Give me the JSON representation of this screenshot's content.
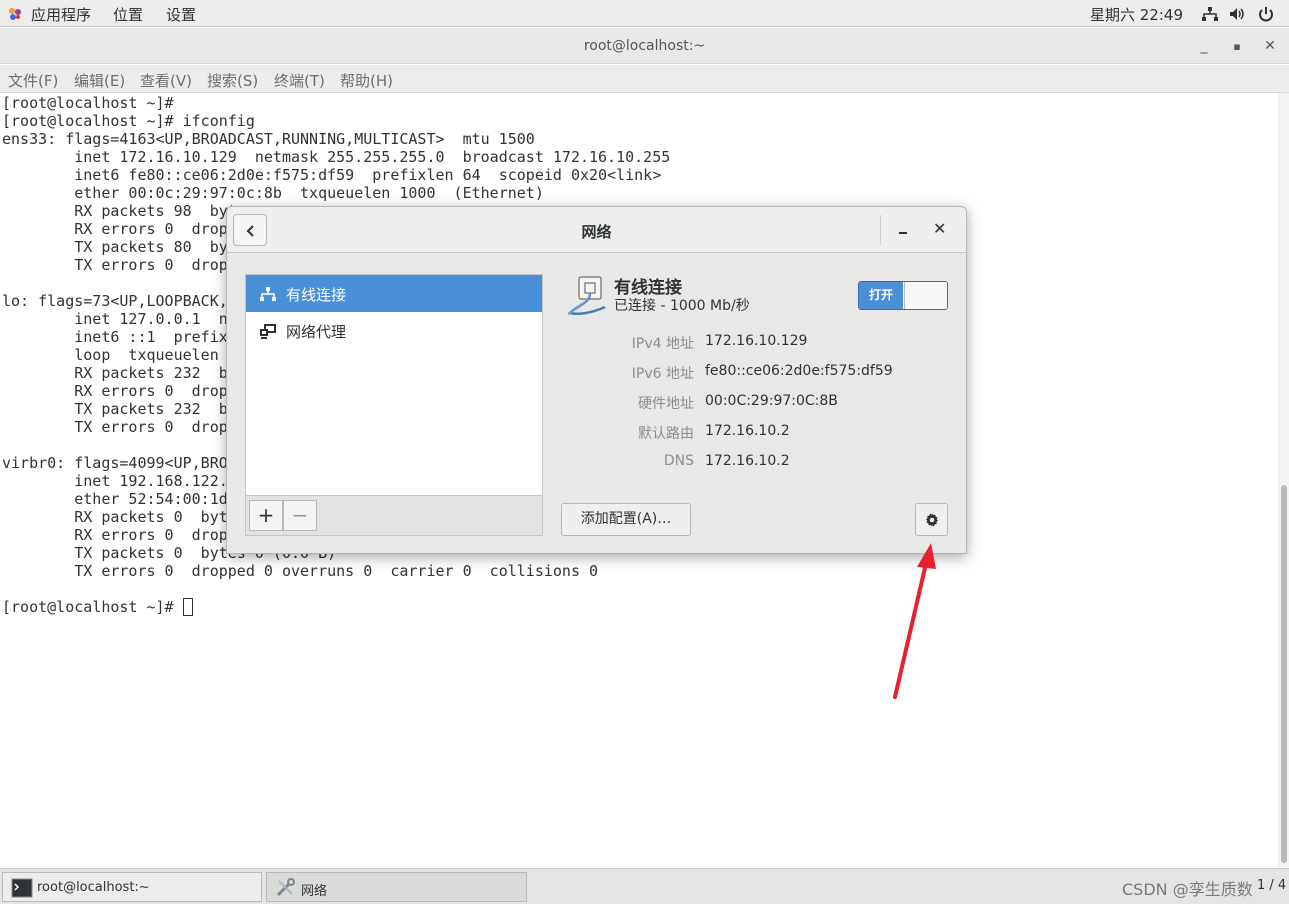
{
  "top_panel": {
    "applications": "应用程序",
    "places": "位置",
    "settings": "设置",
    "clock": "星期六 22:49"
  },
  "terminal": {
    "title": "root@localhost:~",
    "menu": [
      "文件(F)",
      "编辑(E)",
      "查看(V)",
      "搜索(S)",
      "终端(T)",
      "帮助(H)"
    ],
    "lines": [
      "[root@localhost ~]#",
      "[root@localhost ~]# ifconfig",
      "ens33: flags=4163<UP,BROADCAST,RUNNING,MULTICAST>  mtu 1500",
      "        inet 172.16.10.129  netmask 255.255.255.0  broadcast 172.16.10.255",
      "        inet6 fe80::ce06:2d0e:f575:df59  prefixlen 64  scopeid 0x20<link>",
      "        ether 00:0c:29:97:0c:8b  txqueuelen 1000  (Ethernet)",
      "        RX packets 98  byt",
      "        RX errors 0  drop",
      "        TX packets 80  by",
      "        TX errors 0  drop",
      "",
      "lo: flags=73<UP,LOOPBACK,",
      "        inet 127.0.0.1  n",
      "        inet6 ::1  prefix",
      "        loop  txqueuelen",
      "        RX packets 232  b",
      "        RX errors 0  drop",
      "        TX packets 232  b",
      "        TX errors 0  drop",
      "",
      "virbr0: flags=4099<UP,BRO",
      "        inet 192.168.122.",
      "        ether 52:54:00:1d",
      "        RX packets 0  byt",
      "        RX errors 0  drop",
      "        TX packets 0  bytes 0 (0.0 B)",
      "        TX errors 0  dropped 0 overruns 0  carrier 0  collisions 0",
      "",
      "[root@localhost ~]# "
    ]
  },
  "taskbar": {
    "tasks": [
      "root@localhost:~",
      "网络"
    ],
    "workspace": "1 / 4",
    "watermark": "CSDN @孪生质数"
  },
  "network_dialog": {
    "title": "网络",
    "list": [
      {
        "label": "有线连接",
        "icon": "wired-network-icon",
        "selected": true
      },
      {
        "label": "网络代理",
        "icon": "proxy-icon",
        "selected": false
      }
    ],
    "add_symbol": "+",
    "remove_symbol": "−",
    "connection": {
      "name": "有线连接",
      "status": "已连接 - 1000 Mb/秒",
      "toggle_label": "打开",
      "toggle_on": true
    },
    "properties": [
      {
        "key": "IPv4 地址",
        "value": "172.16.10.129"
      },
      {
        "key": "IPv6 地址",
        "value": "fe80::ce06:2d0e:f575:df59"
      },
      {
        "key": "硬件地址",
        "value": "00:0C:29:97:0C:8B"
      },
      {
        "key": "默认路由",
        "value": "172.16.10.2"
      },
      {
        "key": "DNS",
        "value": "172.16.10.2"
      }
    ],
    "add_profile": "添加配置(A)…"
  },
  "colors": {
    "accent": "#4a90d9",
    "annotation_arrow": "#e8202f"
  }
}
